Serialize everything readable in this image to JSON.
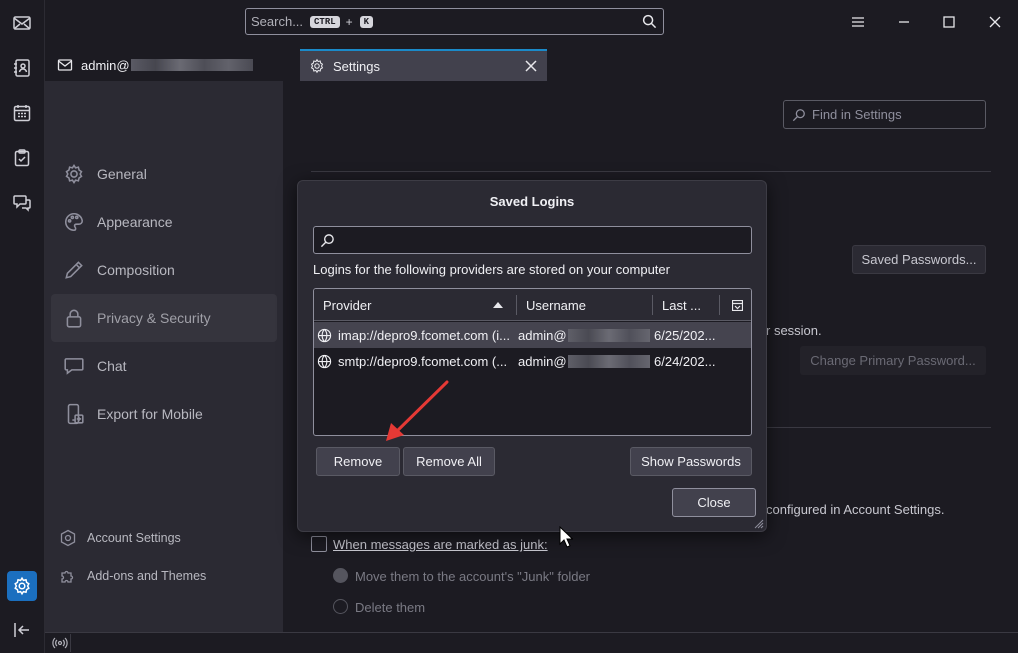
{
  "titlebar": {
    "search_placeholder": "Search...",
    "search_kbd_ctrl": "CTRL",
    "search_kbd_plus": "+",
    "search_kbd_key": "K"
  },
  "tabs": [
    {
      "label": "admin@",
      "icon": "mail-account-icon"
    },
    {
      "label": "Settings",
      "icon": "gear-icon"
    }
  ],
  "sidebar": {
    "categories": [
      {
        "label": "General",
        "icon": "gear-icon"
      },
      {
        "label": "Appearance",
        "icon": "palette-icon"
      },
      {
        "label": "Composition",
        "icon": "pen-icon"
      },
      {
        "label": "Privacy & Security",
        "icon": "lock-icon",
        "active": true
      },
      {
        "label": "Chat",
        "icon": "chat-icon"
      },
      {
        "label": "Export for Mobile",
        "icon": "mobile-icon"
      }
    ],
    "footer": [
      {
        "label": "Account Settings",
        "icon": "account-settings-icon"
      },
      {
        "label": "Add-ons and Themes",
        "icon": "puzzle-icon"
      }
    ]
  },
  "main": {
    "find_placeholder": "Find in Settings",
    "saved_passwords_label": "Saved Passwords...",
    "session_text": "r session.",
    "change_primary_password_label": "Change Primary Password...",
    "configured_text": "configured in Account Settings.",
    "junk_checkbox_label": "When messages are marked as junk:",
    "junk_move_label": "Move them to the account's \"Junk\" folder",
    "junk_delete_label": "Delete them"
  },
  "dialog": {
    "title": "Saved Logins",
    "description": "Logins for the following providers are stored on your computer",
    "columns": {
      "provider": "Provider",
      "username": "Username",
      "last": "Last ..."
    },
    "rows": [
      {
        "provider": "imap://depro9.fcomet.com (i...",
        "username": "admin@",
        "last": "6/25/202...",
        "selected": true
      },
      {
        "provider": "smtp://depro9.fcomet.com (...",
        "username": "admin@",
        "last": "6/24/202...",
        "selected": false
      }
    ],
    "buttons": {
      "remove": "Remove",
      "remove_all": "Remove All",
      "show_passwords": "Show Passwords",
      "close": "Close"
    }
  },
  "colors": {
    "accent": "#1b6fbf",
    "tab_indicator": "#1b8ac9",
    "annotation_arrow": "#e53935"
  }
}
